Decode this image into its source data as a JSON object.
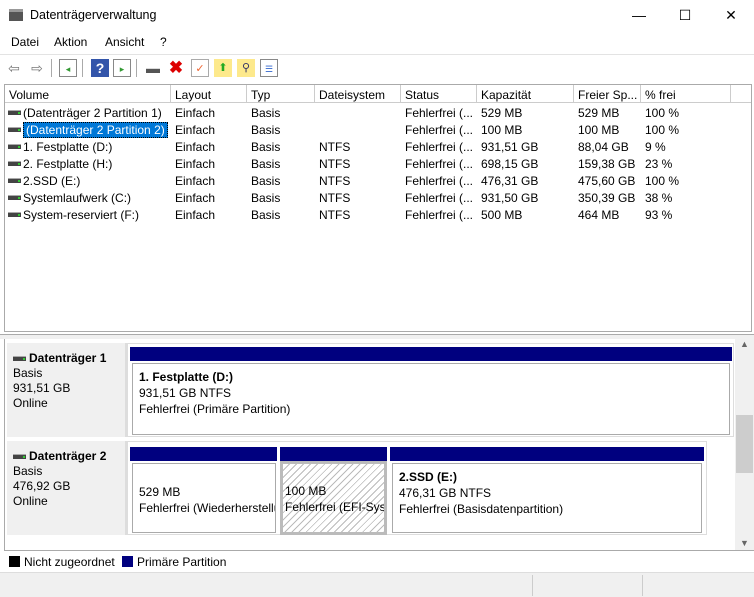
{
  "window": {
    "title": "Datenträgerverwaltung",
    "minimize": "—",
    "maximize": "☐",
    "close": "✕"
  },
  "menu": [
    "Datei",
    "Aktion",
    "Ansicht",
    "?"
  ],
  "toolbar": [
    "back-icon",
    "forward-icon",
    "console-tree-icon",
    "help-icon",
    "action-pane-icon",
    "connect-disk-icon",
    "delete-icon",
    "properties-icon",
    "refresh-icon",
    "rescan-icon",
    "settings-list-icon"
  ],
  "columns": [
    "Volume",
    "Layout",
    "Typ",
    "Dateisystem",
    "Status",
    "Kapazität",
    "Freier Sp...",
    "% frei"
  ],
  "volumes": [
    [
      "(Datenträger 2 Partition 1)",
      "Einfach",
      "Basis",
      "",
      "Fehlerfrei (...",
      "529 MB",
      "529 MB",
      "100 %"
    ],
    [
      "(Datenträger 2 Partition 2)",
      "Einfach",
      "Basis",
      "",
      "Fehlerfrei (...",
      "100 MB",
      "100 MB",
      "100 %"
    ],
    [
      "1. Festplatte (D:)",
      "Einfach",
      "Basis",
      "NTFS",
      "Fehlerfrei (...",
      "931,51 GB",
      "88,04 GB",
      "9 %"
    ],
    [
      "2. Festplatte (H:)",
      "Einfach",
      "Basis",
      "NTFS",
      "Fehlerfrei (...",
      "698,15 GB",
      "159,38 GB",
      "23 %"
    ],
    [
      "2.SSD (E:)",
      "Einfach",
      "Basis",
      "NTFS",
      "Fehlerfrei (...",
      "476,31 GB",
      "475,60 GB",
      "100 %"
    ],
    [
      "Systemlaufwerk (C:)",
      "Einfach",
      "Basis",
      "NTFS",
      "Fehlerfrei (...",
      "931,50 GB",
      "350,39 GB",
      "38 %"
    ],
    [
      "System-reserviert (F:)",
      "Einfach",
      "Basis",
      "NTFS",
      "Fehlerfrei (...",
      "500 MB",
      "464 MB",
      "93 %"
    ]
  ],
  "selected_row": 1,
  "disks": [
    {
      "name": "Datenträger 1",
      "type": "Basis",
      "size": "931,51 GB",
      "state": "Online",
      "partitions": [
        {
          "title": "1. Festplatte  (D:)",
          "size": "931,51 GB NTFS",
          "status": "Fehlerfrei (Primäre Partition)"
        }
      ]
    },
    {
      "name": "Datenträger 2",
      "type": "Basis",
      "size": "476,92 GB",
      "state": "Online",
      "partitions": [
        {
          "title": "",
          "size": "529 MB",
          "status": "Fehlerfrei (Wiederherstellu"
        },
        {
          "title": "",
          "size": "100 MB",
          "status": "Fehlerfrei (EFI-Sys"
        },
        {
          "title": "2.SSD  (E:)",
          "size": "476,31 GB NTFS",
          "status": "Fehlerfrei (Basisdatenpartition)"
        }
      ]
    }
  ],
  "legend": [
    {
      "label": "Nicht zugeordnet",
      "color": "#000000"
    },
    {
      "label": "Primäre Partition",
      "color": "#00007f"
    }
  ]
}
